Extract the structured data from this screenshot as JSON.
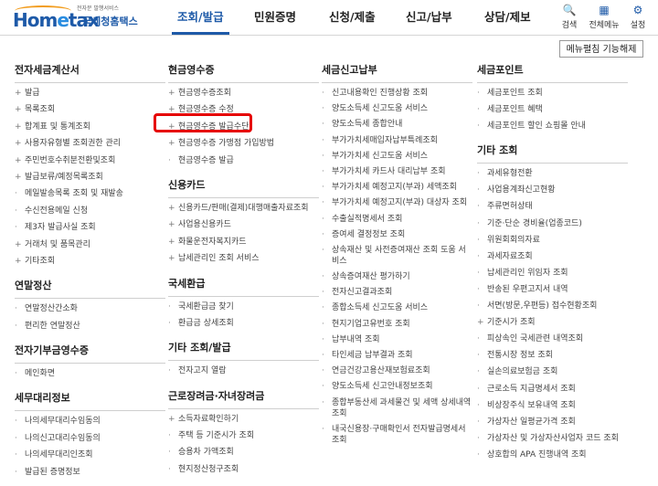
{
  "header": {
    "logo": {
      "main_a": "Hom",
      "main_b": "e",
      "main_c": "tax",
      "sub": "전자문 발행서비스",
      "name": "국세청홈택스"
    },
    "nav": [
      "조회/발급",
      "민원증명",
      "신청/제출",
      "신고/납부",
      "상담/제보"
    ],
    "active_nav": "조회/발급",
    "utilities": [
      {
        "icon": "search-icon",
        "label": "검색"
      },
      {
        "icon": "grid-icon",
        "label": "전체메뉴"
      },
      {
        "icon": "gear-icon",
        "label": "설정"
      }
    ],
    "accent_color": "#1e5aa8"
  },
  "edit_button": "메뉴펼침 기능해제",
  "columns": [
    {
      "sections": [
        {
          "title": "전자세금계산서",
          "items": [
            {
              "m": "+",
              "t": "발급"
            },
            {
              "m": "+",
              "t": "목록조회"
            },
            {
              "m": "+",
              "t": "합계표 및 통계조회"
            },
            {
              "m": "+",
              "t": "사용자유형별 조회권한 관리"
            },
            {
              "m": "+",
              "t": "주민번호수취분전환및조회"
            },
            {
              "m": "+",
              "t": "발급보류/예정목록조회"
            },
            {
              "m": "·",
              "t": "메일발송목록 조회 및 재발송"
            },
            {
              "m": "·",
              "t": "수신전용메일 신청"
            },
            {
              "m": "·",
              "t": "제3자 발급사실 조회"
            },
            {
              "m": "+",
              "t": "거래처 및 품목관리"
            },
            {
              "m": "+",
              "t": "기타조회"
            }
          ]
        },
        {
          "title": "연말정산",
          "items": [
            {
              "m": "·",
              "t": "연말정산간소화"
            },
            {
              "m": "·",
              "t": "편리한 연말정산"
            }
          ]
        },
        {
          "title": "전자기부금영수증",
          "items": [
            {
              "m": "·",
              "t": "메인화면"
            }
          ]
        },
        {
          "title": "세무대리정보",
          "items": [
            {
              "m": "·",
              "t": "나의세무대리수임동의"
            },
            {
              "m": "·",
              "t": "나의신고대리수임동의"
            },
            {
              "m": "·",
              "t": "나의세무대리인조회"
            },
            {
              "m": "·",
              "t": "발급된 증명정보"
            }
          ]
        }
      ]
    },
    {
      "sections": [
        {
          "title": "현금영수증",
          "items": [
            {
              "m": "+",
              "t": "현금영수증조회"
            },
            {
              "m": "+",
              "t": "현금영수증 수정"
            },
            {
              "m": "+",
              "t": "현금영수증 발급수단"
            },
            {
              "m": "+",
              "t": "현금영수증 가맹점 가입방법"
            },
            {
              "m": "·",
              "t": "현금영수증 발급"
            }
          ]
        },
        {
          "title": "신용카드",
          "items": [
            {
              "m": "+",
              "t": "신용카드/판매(결제)대행매출자료조회"
            },
            {
              "m": "+",
              "t": "사업용신용카드"
            },
            {
              "m": "+",
              "t": "화물운전자복지카드"
            },
            {
              "m": "+",
              "t": "납세관리인 조회 서비스"
            }
          ]
        },
        {
          "title": "국세환급",
          "items": [
            {
              "m": "·",
              "t": "국세환급금 찾기"
            },
            {
              "m": "·",
              "t": "환급금 상세조회"
            }
          ]
        },
        {
          "title": "기타 조회/발급",
          "items": [
            {
              "m": "·",
              "t": "전자고지 열람"
            }
          ]
        },
        {
          "title": "근로장려금·자녀장려금",
          "items": [
            {
              "m": "+",
              "t": "소득자료확인하기"
            },
            {
              "m": "·",
              "t": "주택 등 기준시가 조회"
            },
            {
              "m": "·",
              "t": "승용차 가액조회"
            },
            {
              "m": "·",
              "t": "현지정산청구조회"
            }
          ]
        }
      ]
    },
    {
      "sections": [
        {
          "title": "세금신고납부",
          "items": [
            {
              "m": "·",
              "t": "신고내용확인 진행상황 조회"
            },
            {
              "m": "·",
              "t": "양도소득세 신고도움 서비스"
            },
            {
              "m": "·",
              "t": "양도소득세 종합안내"
            },
            {
              "m": "·",
              "t": "부가가치세매입자납부특례조회"
            },
            {
              "m": "·",
              "t": "부가가치세 신고도움 서비스"
            },
            {
              "m": "·",
              "t": "부가가치세 카드사 대리납부 조회"
            },
            {
              "m": "·",
              "t": "부가가치세 예정고지(부과) 세액조회"
            },
            {
              "m": "·",
              "t": "부가가치세 예정고지(부과) 대상자 조회"
            },
            {
              "m": "·",
              "t": "수출실적명세서 조회"
            },
            {
              "m": "·",
              "t": "증여세 결정정보 조회"
            },
            {
              "m": "·",
              "t": "상속재산 및 사전증여재산 조회 도움 서비스"
            },
            {
              "m": "·",
              "t": "상속증여재산 평가하기"
            },
            {
              "m": "·",
              "t": "전자신고결과조회"
            },
            {
              "m": "·",
              "t": "종합소득세 신고도움 서비스"
            },
            {
              "m": "·",
              "t": "현지기업고유번호 조회"
            },
            {
              "m": "·",
              "t": "납부내역 조회"
            },
            {
              "m": "·",
              "t": "타인세금 납부결과 조회"
            },
            {
              "m": "·",
              "t": "연금건강고용산재보험료조회"
            },
            {
              "m": "·",
              "t": "양도소득세 신고안내정보조회"
            },
            {
              "m": "·",
              "t": "종합부동산세 과세물건 및 세액 상세내역 조회"
            },
            {
              "m": "·",
              "t": "내국신용장·구매확인서 전자발급명세서 조회"
            }
          ]
        }
      ]
    },
    {
      "sections": [
        {
          "title": "세금포인트",
          "items": [
            {
              "m": "·",
              "t": "세금포인트 조회"
            },
            {
              "m": "·",
              "t": "세금포인트 혜택"
            },
            {
              "m": "·",
              "t": "세금포인트 할인 쇼핑몰 안내"
            }
          ]
        },
        {
          "title": "기타 조회",
          "items": [
            {
              "m": "·",
              "t": "과세유형전환"
            },
            {
              "m": "·",
              "t": "사업용계좌신고현황"
            },
            {
              "m": "·",
              "t": "주류면허상태"
            },
            {
              "m": "·",
              "t": "기준·단순 경비율(업종코드)"
            },
            {
              "m": "·",
              "t": "위원회회의자료"
            },
            {
              "m": "·",
              "t": "과세자료조회"
            },
            {
              "m": "·",
              "t": "납세관리인 위임자 조회"
            },
            {
              "m": "·",
              "t": "반송된 우편고지서 내역"
            },
            {
              "m": "·",
              "t": "서면(방문,우편등) 접수현황조회"
            },
            {
              "m": "+",
              "t": "기준시가 조회"
            },
            {
              "m": "·",
              "t": "피상속인 국세관련 내역조회"
            },
            {
              "m": "·",
              "t": "전통시장 정보 조회"
            },
            {
              "m": "·",
              "t": "실손의료보험금 조회"
            },
            {
              "m": "·",
              "t": "근로소득 지급명세서 조회"
            },
            {
              "m": "·",
              "t": "비상장주식 보유내역 조회"
            },
            {
              "m": "·",
              "t": "가상자산 일평균가격 조회"
            },
            {
              "m": "·",
              "t": "가상자산 및 가상자산사업자 코드 조회"
            },
            {
              "m": "·",
              "t": "상호합의 APA 진행내역 조회"
            }
          ]
        }
      ]
    }
  ]
}
